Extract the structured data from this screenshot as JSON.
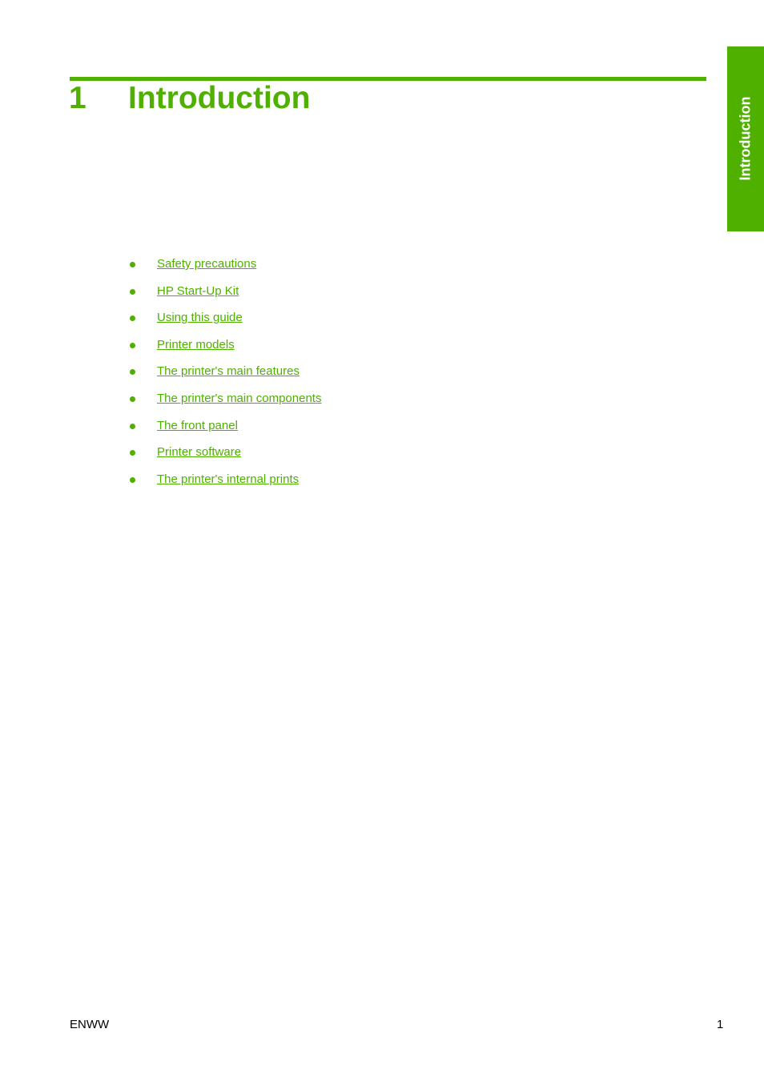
{
  "chapter": {
    "number": "1",
    "title": "Introduction",
    "accent_color": "#4fb000"
  },
  "side_tab": {
    "label": "Introduction"
  },
  "toc": [
    {
      "label": "Safety precautions"
    },
    {
      "label": "HP Start-Up Kit"
    },
    {
      "label": "Using this guide"
    },
    {
      "label": "Printer models"
    },
    {
      "label": "The printer's main features"
    },
    {
      "label": "The printer's main components"
    },
    {
      "label": "The front panel"
    },
    {
      "label": "Printer software"
    },
    {
      "label": "The printer's internal prints"
    }
  ],
  "footer": {
    "left": "ENWW",
    "page_number": "1"
  }
}
